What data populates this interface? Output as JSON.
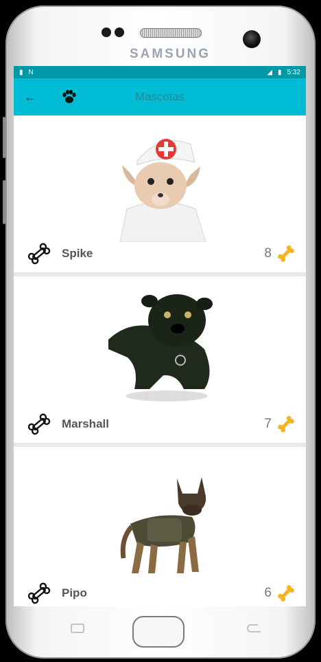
{
  "device": {
    "brand": "SAMSUNG"
  },
  "status_bar": {
    "left_icons": [
      "sim-icon",
      "nfc-icon"
    ],
    "right_icons": [
      "no-signal-icon",
      "battery-icon"
    ],
    "time": "5:32"
  },
  "app_bar": {
    "title": "Mascotas",
    "back_icon": "arrow-left-icon",
    "logo_icon": "paw-icon"
  },
  "pets": [
    {
      "name": "Spike",
      "rating": "8",
      "image": "chihuahua-nurse"
    },
    {
      "name": "Marshall",
      "rating": "7",
      "image": "black-pug"
    },
    {
      "name": "Pipo",
      "rating": "6",
      "image": "german-shepherd"
    }
  ],
  "colors": {
    "status_bar": "#0097a7",
    "app_bar": "#00bcd4",
    "title": "#1f8a99",
    "bone_gold": "#f6b51f"
  }
}
